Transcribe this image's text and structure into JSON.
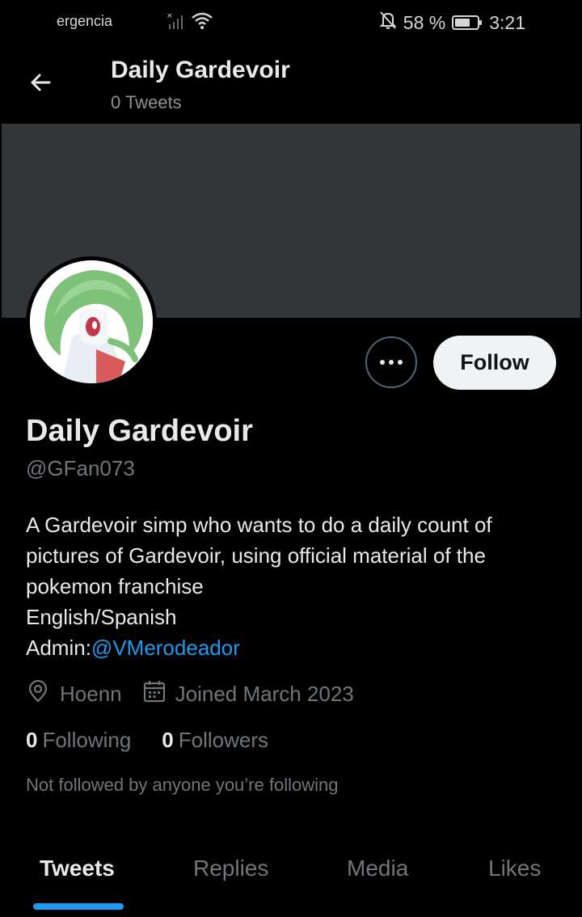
{
  "status_bar": {
    "carrier": "ergencia",
    "battery_percent": "58 %",
    "time": "3:21"
  },
  "header": {
    "title": "Daily Gardevoir",
    "subtitle": "0 Tweets"
  },
  "profile": {
    "name": "Daily Gardevoir",
    "handle": "@GFan073",
    "follow_label": "Follow",
    "bio": {
      "line1": "A Gardevoir simp who wants to do a daily count of pictures of Gardevoir, using official material of the pokemon franchise",
      "line2": "English/Spanish",
      "admin_label": "Admin:",
      "admin_link": "@VMerodeador"
    },
    "location": "Hoenn",
    "joined": "Joined March 2023",
    "following_count": "0",
    "following_label": "Following",
    "followers_count": "0",
    "followers_label": "Followers",
    "not_followed_text": "Not followed by anyone you’re following"
  },
  "tabs": [
    {
      "label": "Tweets",
      "active": true
    },
    {
      "label": "Replies",
      "active": false
    },
    {
      "label": "Media",
      "active": false
    },
    {
      "label": "Likes",
      "active": false
    }
  ],
  "colors": {
    "accent": "#1d9bf0",
    "background": "#000000",
    "banner": "#333639",
    "text_primary": "#e7e9ea",
    "text_secondary": "#71767b"
  },
  "icons": {
    "back": "arrow-left-icon",
    "more": "more-horizontal-icon",
    "location": "location-pin-icon",
    "calendar": "calendar-icon",
    "signal": "signal-icon",
    "wifi": "wifi-icon",
    "mute": "bell-off-icon",
    "battery": "battery-icon"
  }
}
